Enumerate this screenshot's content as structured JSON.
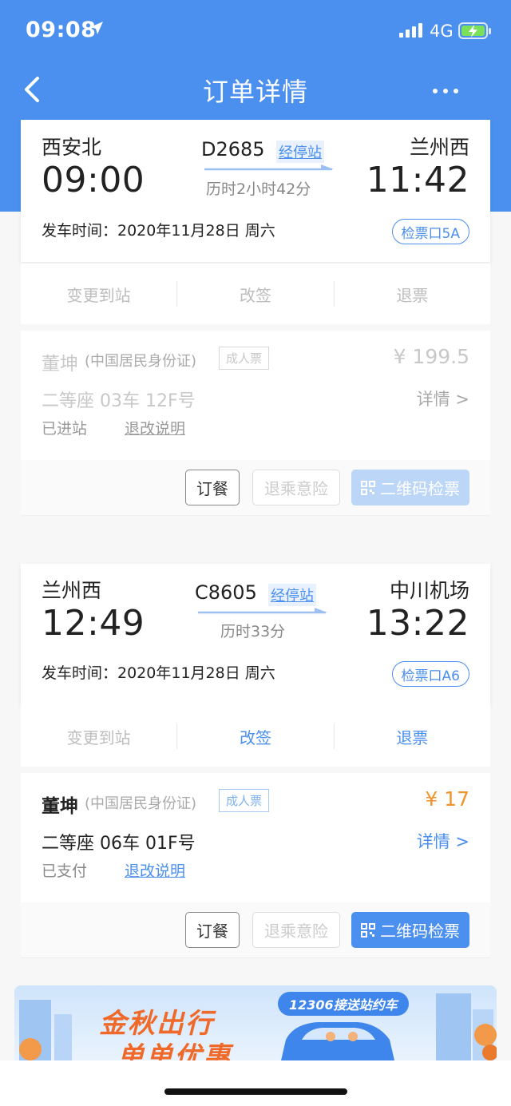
{
  "status_bar": {
    "time": "09:08",
    "network": "4G"
  },
  "nav": {
    "title": "订单详情"
  },
  "legs": [
    {
      "from_station": "西安北",
      "depart_time": "09:00",
      "train_no": "D2685",
      "stops_label": "经停站",
      "duration": "历时2小时42分",
      "to_station": "兰州西",
      "arrive_time": "11:42",
      "depart_date": "发车时间：2020年11月28日 周六",
      "gate": "检票口5A",
      "actions": [
        "变更到站",
        "改签",
        "退票"
      ],
      "passenger": {
        "name": "董坤",
        "id_type": "(中国居民身份证)",
        "ticket_type": "成人票",
        "price": "¥ 199.5",
        "seat": "二等座 03车 12F号",
        "detail_label": "详情 >",
        "status": "已进站",
        "refund_note": "退改说明"
      },
      "buttons": {
        "meal": "订餐",
        "insurance": "退乘意险",
        "qr": "二维码检票"
      }
    },
    {
      "from_station": "兰州西",
      "depart_time": "12:49",
      "train_no": "C8605",
      "stops_label": "经停站",
      "duration": "历时33分",
      "to_station": "中川机场",
      "arrive_time": "13:22",
      "depart_date": "发车时间：2020年11月28日 周六",
      "gate": "检票口A6",
      "actions": [
        "变更到站",
        "改签",
        "退票"
      ],
      "passenger": {
        "name": "董坤",
        "id_type": "(中国居民身份证)",
        "ticket_type": "成人票",
        "price": "¥ 17",
        "seat": "二等座 06车 01F号",
        "detail_label": "详情 >",
        "status": "已支付",
        "refund_note": "退改说明"
      },
      "buttons": {
        "meal": "订餐",
        "insurance": "退乘意险",
        "qr": "二维码检票"
      }
    }
  ],
  "banner": {
    "line1": "金秋出行",
    "line2": "单单优惠",
    "tag": "12306接送站约车"
  },
  "colors": {
    "primary": "#4b8fef",
    "price": "#f0932b",
    "qr_disabled": "#bcd6f8",
    "qr_active": "#4b8fef"
  }
}
